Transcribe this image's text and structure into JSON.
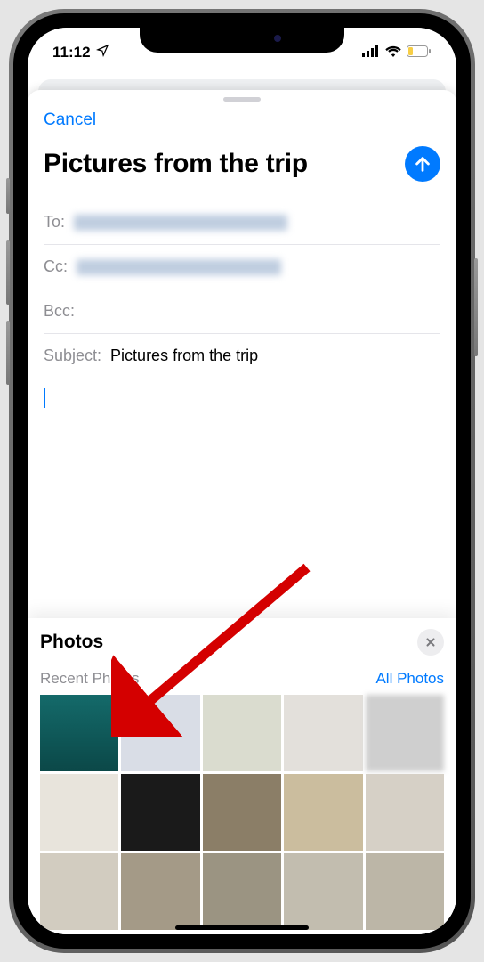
{
  "statusBar": {
    "time": "11:12"
  },
  "composer": {
    "cancel": "Cancel",
    "title": "Pictures from the trip",
    "fields": {
      "toLabel": "To:",
      "ccLabel": "Cc:",
      "bccLabel": "Bcc:",
      "subjectLabel": "Subject:",
      "subjectValue": "Pictures from the trip"
    }
  },
  "photosPanel": {
    "title": "Photos",
    "recentLabel": "Recent Photos",
    "allPhotosLabel": "All Photos"
  }
}
